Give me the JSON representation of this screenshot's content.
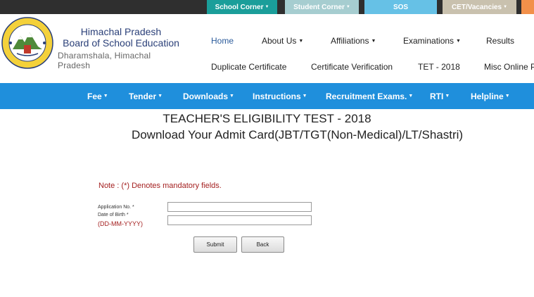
{
  "top_tabs": [
    {
      "label": "School Corner",
      "has_caret": true
    },
    {
      "label": "Student Corner",
      "has_caret": true
    },
    {
      "label": "SOS",
      "has_caret": false
    },
    {
      "label": "CET/Vacancies",
      "has_caret": true
    }
  ],
  "header": {
    "org_line1": "Himachal Pradesh",
    "org_line2": "Board of School Education",
    "org_place": "Dharamshala, Himachal Pradesh"
  },
  "main_nav": {
    "row1": [
      "Home",
      "About Us",
      "Affiliations",
      "Examinations",
      "Results"
    ],
    "row2": [
      "Duplicate Certificate",
      "Certificate Verification",
      "TET - 2018",
      "Misc Online Pa"
    ]
  },
  "blue_nav": [
    "Fee",
    "Tender",
    "Downloads",
    "Instructions",
    "Recruitment Exams.",
    "RTI",
    "Helpline"
  ],
  "page": {
    "title": "TEACHER'S ELIGIBILITY TEST - 2018",
    "subtitle": "Download Your Admit Card(JBT/TGT(Non-Medical)/LT/Shastri)",
    "note": "Note  : (*) Denotes mandatory fields."
  },
  "form": {
    "application_label": "Application No. *",
    "dob_label": "Date of Birth *",
    "dob_format": "(DD-MM-YYYY)",
    "application_value": "",
    "dob_value": "",
    "submit_label": "Submit",
    "back_label": "Back"
  },
  "colors": {
    "top_strip": "#2f2f2f",
    "blue_bar": "#1f8fdc",
    "note_red": "#a42020"
  }
}
